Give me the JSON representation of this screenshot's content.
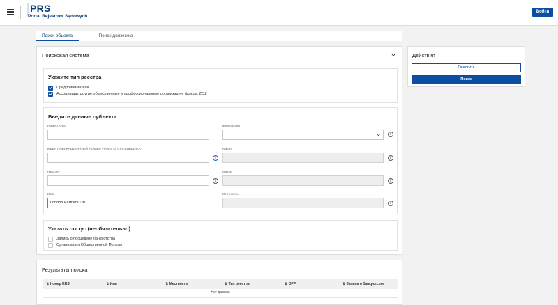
{
  "header": {
    "logo_title": "PRS",
    "logo_subtitle": "Portal Rejestrów Sądowych",
    "login_label": "Войти"
  },
  "tabs": [
    {
      "label": "Поиск объекта",
      "active": true
    },
    {
      "label": "Поиск должника",
      "active": false
    }
  ],
  "search": {
    "title": "Поисковая система",
    "registry": {
      "title": "Укажите тип реестра",
      "options": [
        {
          "label": "Предприниматели",
          "checked": true
        },
        {
          "label": "Ассоциации, другие общественные и профессиональные организации, фонды, ZOZ",
          "checked": true
        }
      ]
    },
    "subject": {
      "title": "Введите данные субъекта",
      "fields": {
        "krs": {
          "label": "Номер KRS",
          "value": ""
        },
        "voivodeship": {
          "label": "Воеводство",
          "value": ""
        },
        "nip": {
          "label": "ИДЕНТИФИКАЦИОННЫЙ НОМЕР НАЛОГОПЛАТЕЛЬЩИКА",
          "value": ""
        },
        "district": {
          "label": "Район",
          "value": ""
        },
        "regon": {
          "label": "REGON",
          "value": ""
        },
        "commune": {
          "label": "Гмина",
          "value": ""
        },
        "name": {
          "label": "Имя",
          "value": "London Partners Ltd."
        },
        "locality": {
          "label": "Местность",
          "value": ""
        }
      }
    },
    "status": {
      "title": "Указать статус (необязательно)",
      "options": [
        {
          "label": "Запись о процедуре банкротства",
          "checked": false
        },
        {
          "label": "Организация Общественной Пользы",
          "checked": false
        }
      ]
    }
  },
  "actions": {
    "title": "Действия",
    "clear_label": "Очистить",
    "search_label": "Поиск"
  },
  "results": {
    "title": "Результаты поиска",
    "columns": [
      "Номер KRS",
      "Имя",
      "Местность",
      "Тип реестра",
      "OPP",
      "Записи о банкротстве"
    ],
    "sort_icon": "⇅",
    "empty_text": "Нет данных"
  },
  "icons": {
    "menu": "hamburger-icon",
    "info": "info-icon",
    "chevron": "chevron-down-icon"
  },
  "colors": {
    "brand": "#0b4ea2",
    "brand_dark": "#0b3d78",
    "focus": "#4a9d5b"
  }
}
